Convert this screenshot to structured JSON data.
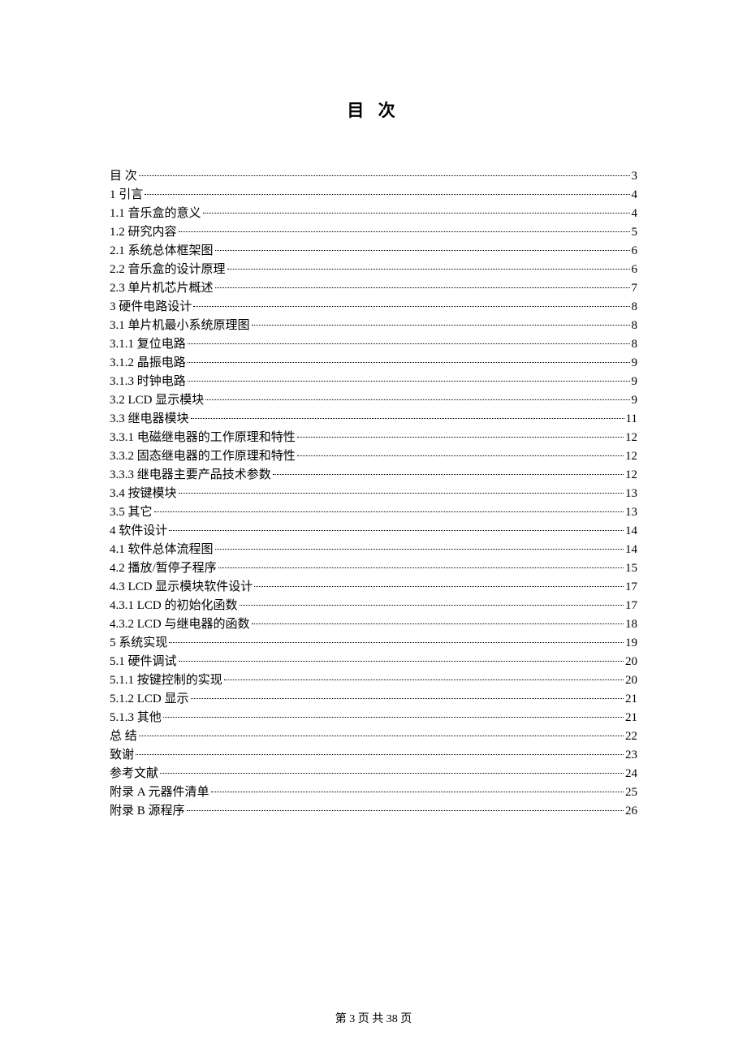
{
  "title": "目  次",
  "footer": {
    "prefix": "第",
    "page": "3",
    "mid": "页 共",
    "total": "38",
    "suffix": "页"
  },
  "toc": [
    {
      "label": "目  次",
      "page": "3"
    },
    {
      "label": "1 引言",
      "page": "4"
    },
    {
      "label": "1.1  音乐盒的意义",
      "page": "4"
    },
    {
      "label": "1.2  研究内容",
      "page": "5"
    },
    {
      "label": "2.1 系统总体框架图",
      "page": "6"
    },
    {
      "label": "2.2 音乐盒的设计原理",
      "page": "6"
    },
    {
      "label": "2.3 单片机芯片概述",
      "page": "7"
    },
    {
      "label": "3 硬件电路设计",
      "page": "8"
    },
    {
      "label": "3.1 单片机最小系统原理图",
      "page": "8"
    },
    {
      "label": "3.1.1 复位电路",
      "page": "8"
    },
    {
      "label": "3.1.2 晶振电路",
      "page": "9"
    },
    {
      "label": "3.1.3 时钟电路",
      "page": "9"
    },
    {
      "label": "3.2  LCD 显示模块",
      "page": "9"
    },
    {
      "label": "3.3  继电器模块",
      "page": "11"
    },
    {
      "label": "3.3.1 电磁继电器的工作原理和特性",
      "page": "12"
    },
    {
      "label": "3.3.2 固态继电器的工作原理和特性",
      "page": "12"
    },
    {
      "label": "3.3.3 继电器主要产品技术参数",
      "page": "12"
    },
    {
      "label": "3.4 按键模块",
      "page": "13"
    },
    {
      "label": "3.5  其它",
      "page": "13"
    },
    {
      "label": "4 软件设计",
      "page": "14"
    },
    {
      "label": "4.1 软件总体流程图",
      "page": "14"
    },
    {
      "label": "4.2 播放/暂停子程序",
      "page": "15"
    },
    {
      "label": "4.3 LCD 显示模块软件设计",
      "page": "17"
    },
    {
      "label": "4.3.1 LCD 的初始化函数",
      "page": "17"
    },
    {
      "label": "4.3.2 LCD 与继电器的函数",
      "page": "18"
    },
    {
      "label": "5 系统实现",
      "page": "19"
    },
    {
      "label": "5.1 硬件调试",
      "page": "20"
    },
    {
      "label": "5.1.1 按键控制的实现",
      "page": "20"
    },
    {
      "label": "5.1.2  LCD 显示",
      "page": "21"
    },
    {
      "label": "5.1.3 其他",
      "page": "21"
    },
    {
      "label": "总 结",
      "page": "22"
    },
    {
      "label": "致谢",
      "page": "23"
    },
    {
      "label": "参考文献",
      "page": "24"
    },
    {
      "label": "附录 A 元器件清单",
      "page": "25"
    },
    {
      "label": "附录 B 源程序",
      "page": "26"
    }
  ]
}
